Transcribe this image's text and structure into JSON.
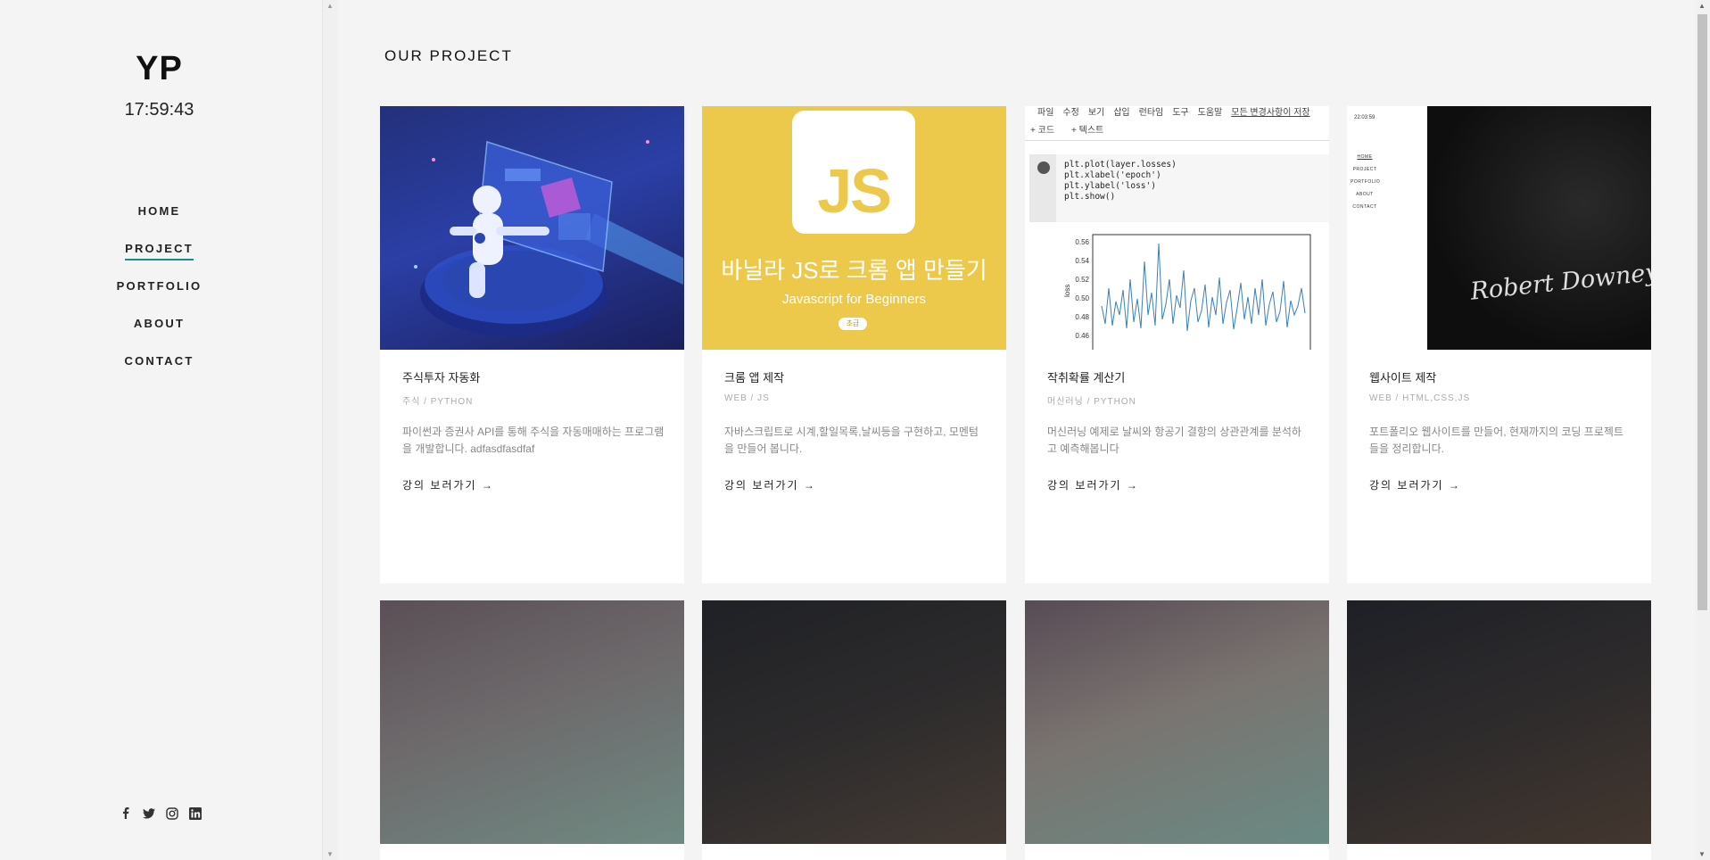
{
  "sidebar": {
    "logo": "YP",
    "clock": "17:59:43",
    "nav": [
      {
        "label": "HOME"
      },
      {
        "label": "PROJECT",
        "active": true
      },
      {
        "label": "PORTFOLIO"
      },
      {
        "label": "ABOUT"
      },
      {
        "label": "CONTACT"
      }
    ],
    "social": [
      "facebook-icon",
      "twitter-icon",
      "instagram-icon",
      "linkedin-icon"
    ]
  },
  "main": {
    "section_title": "OUR PROJECT",
    "cards": [
      {
        "title": "주식투자 자동화",
        "category": "주식 / PYTHON",
        "description": "파이썬과 증권사 API를 통해 주식을 자동매매하는 프로그램을 개발합니다. adfasdfasdfaf",
        "more": "강의 보러가기"
      },
      {
        "title": "크롬 앱 제작",
        "category": "WEB / JS",
        "description": "자바스크립트로 시계,할일목록,날씨등을 구현하고, 모멘텀을 만들어 봅니다.",
        "more": "강의 보러가기",
        "thumb_text": {
          "logo": "JS",
          "headline": "바닐라 JS로 크롬 앱 만들기",
          "sub": "Javascript for Beginners",
          "badge": "초급"
        }
      },
      {
        "title": "작취확률 계산기",
        "category": "머신러닝 / PYTHON",
        "description": "머신러닝 예제로 날씨와 항공기 결항의 상관관계를 분석하고 예측해봅니다",
        "more": "강의 보러가기",
        "thumb_text": {
          "menu": [
            "파일",
            "수정",
            "보기",
            "삽입",
            "런타임",
            "도구",
            "도움말",
            "모든 변경사항이 저장"
          ],
          "toolbar": [
            "+ 코드",
            "+ 텍스트"
          ],
          "code": [
            "plt.plot(layer.losses)",
            "plt.xlabel('epoch')",
            "plt.ylabel('loss')",
            "plt.show()"
          ],
          "yticks": [
            "0.56",
            "0.54",
            "0.52",
            "0.50",
            "0.48",
            "0.46"
          ],
          "ylabel": "loss"
        }
      },
      {
        "title": "웹사이트 제작",
        "category": "WEB / HTML,CSS,JS",
        "description": "포트폴리오 웹사이트를 만들어, 현재까지의 코딩 프로젝트들을 정리합니다.",
        "more": "강의 보러가기",
        "thumb_text": {
          "clock": "22:03:59",
          "menu": [
            "HOME",
            "PROJECT",
            "PORTFOLIO",
            "ABOUT",
            "CONTACT"
          ],
          "signature": "Robert Downey Jr"
        }
      }
    ]
  },
  "colors": {
    "accent": "#1a8a8a",
    "js_yellow": "#ecc94b"
  }
}
